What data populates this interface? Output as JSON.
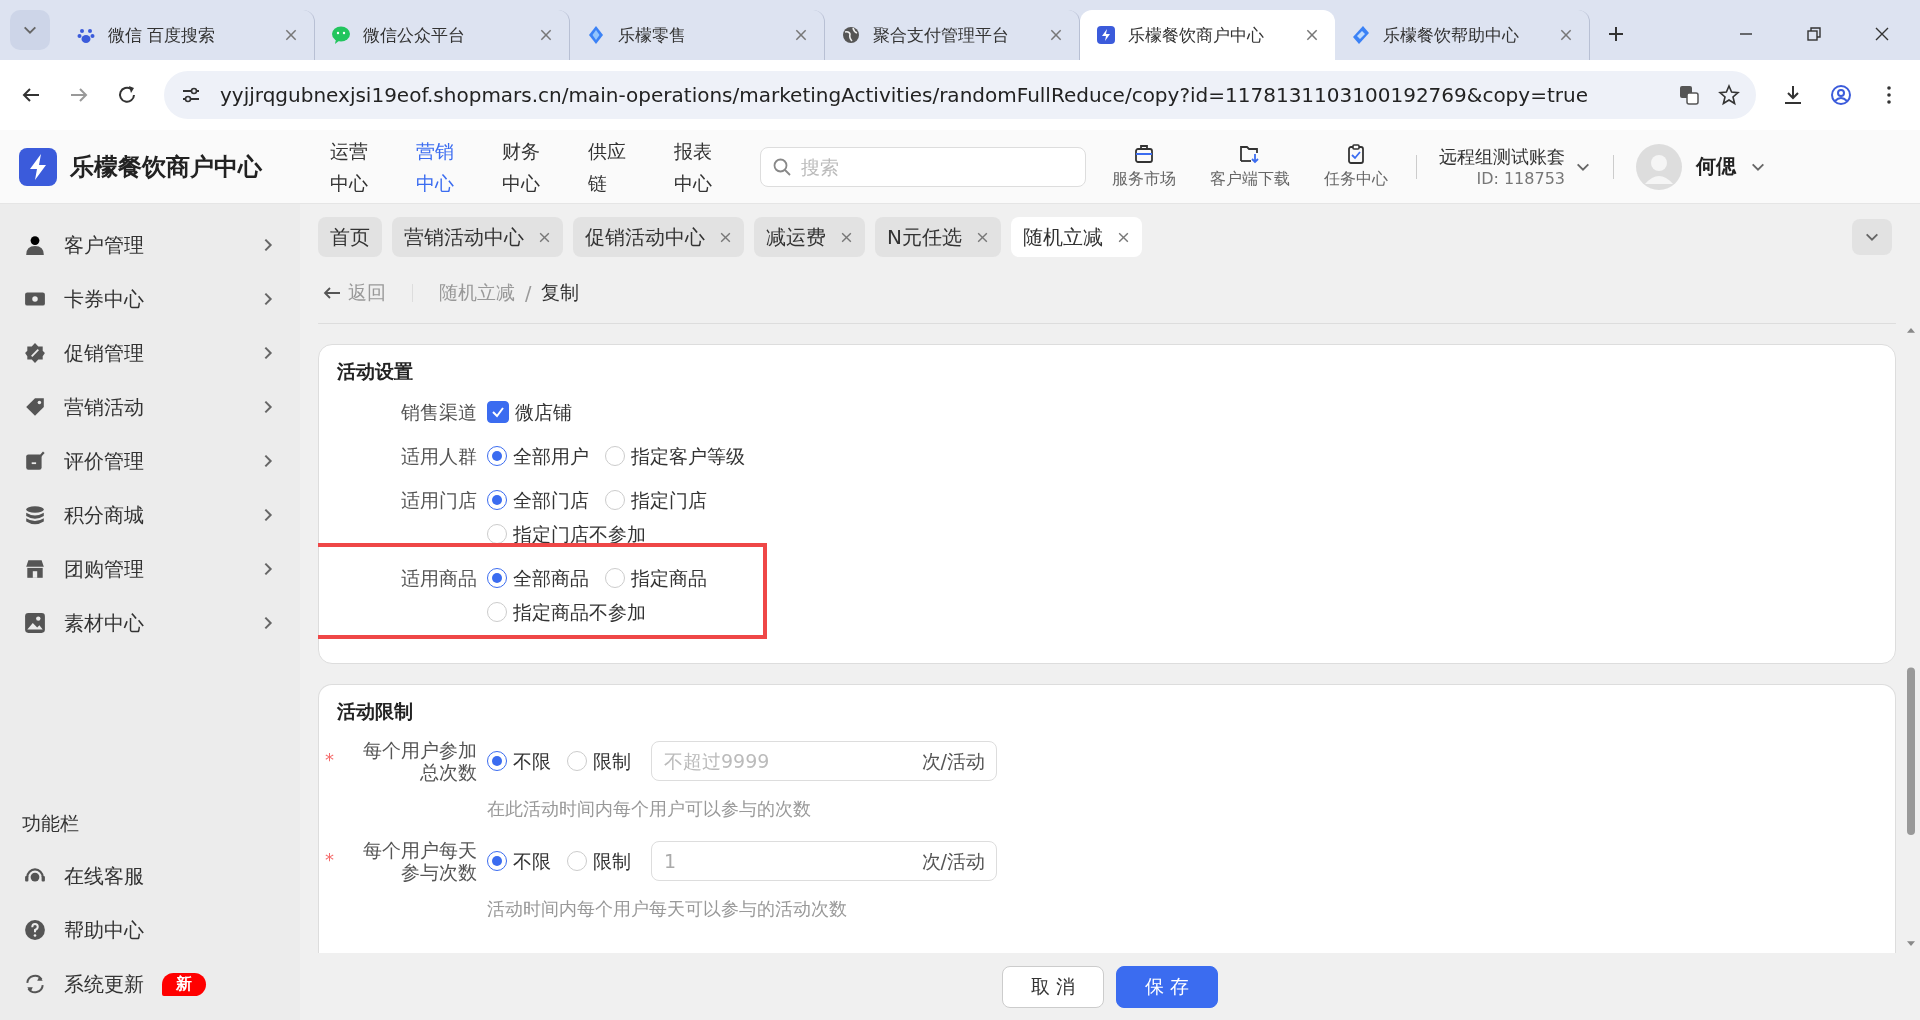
{
  "browser": {
    "tabs": [
      {
        "title": "微信 百度搜索",
        "selected": false
      },
      {
        "title": "微信公众平台",
        "selected": false
      },
      {
        "title": "乐檬零售",
        "selected": false
      },
      {
        "title": "聚合支付管理平台",
        "selected": false
      },
      {
        "title": "乐檬餐饮商户中心",
        "selected": true
      },
      {
        "title": "乐檬餐饮帮助中心",
        "selected": false
      }
    ],
    "url": "yyjjrqgubnexjsi19eof.shopmars.cn/main-operations/marketingActivities/randomFullReduce/copy?id=1178131103100192769&copy=true"
  },
  "header": {
    "logo": "乐檬餐饮商户中心",
    "nav": [
      {
        "label": "运营中心",
        "selected": false
      },
      {
        "label": "营销中心",
        "selected": true
      },
      {
        "label": "财务中心",
        "selected": false
      },
      {
        "label": "供应链",
        "selected": false
      },
      {
        "label": "报表中心",
        "selected": false
      }
    ],
    "search": {
      "placeholder": "搜索"
    },
    "tools": [
      {
        "label": "服务市场"
      },
      {
        "label": "客户端下载"
      },
      {
        "label": "任务中心"
      }
    ],
    "account": {
      "name": "远程组测试账套",
      "id": "ID: 118753"
    },
    "user": "何偲"
  },
  "sidebar": {
    "items": [
      {
        "label": "客户管理"
      },
      {
        "label": "卡券中心"
      },
      {
        "label": "促销管理"
      },
      {
        "label": "营销活动"
      },
      {
        "label": "评价管理"
      },
      {
        "label": "积分商城"
      },
      {
        "label": "团购管理"
      },
      {
        "label": "素材中心"
      }
    ],
    "section_title": "功能栏",
    "tools": [
      {
        "label": "在线客服"
      },
      {
        "label": "帮助中心"
      },
      {
        "label": "系统更新",
        "badge": "新"
      }
    ]
  },
  "page_tabs": [
    {
      "label": "首页",
      "closable": false,
      "selected": false
    },
    {
      "label": "营销活动中心",
      "closable": true,
      "selected": false
    },
    {
      "label": "促销活动中心",
      "closable": true,
      "selected": false
    },
    {
      "label": "减运费",
      "closable": true,
      "selected": false
    },
    {
      "label": "N元任选",
      "closable": true,
      "selected": false
    },
    {
      "label": "随机立减",
      "closable": true,
      "selected": true
    }
  ],
  "breadcrumb": {
    "back": "返回",
    "items": [
      "随机立减",
      "复制"
    ],
    "separator": "/"
  },
  "sections": [
    {
      "title": "活动设置",
      "rows": [
        {
          "kind": "checkbox",
          "label": "销售渠道",
          "options": [
            {
              "label": "微店铺",
              "checked": true
            }
          ]
        },
        {
          "kind": "radio",
          "label": "适用人群",
          "options": [
            {
              "label": "全部用户",
              "selected": true
            },
            {
              "label": "指定客户等级",
              "selected": false
            }
          ]
        },
        {
          "kind": "radio",
          "label": "适用门店",
          "options": [
            {
              "label": "全部门店",
              "selected": true
            },
            {
              "label": "指定门店",
              "selected": false
            },
            {
              "label": "指定门店不参加",
              "selected": false
            }
          ]
        },
        {
          "kind": "radio",
          "label": "适用商品",
          "highlighted": true,
          "options": [
            {
              "label": "全部商品",
              "selected": true
            },
            {
              "label": "指定商品",
              "selected": false
            },
            {
              "label": "指定商品不参加",
              "selected": false
            }
          ]
        }
      ]
    },
    {
      "title": "活动限制",
      "rows": [
        {
          "kind": "radio_input",
          "label": "每个用户参加总次数",
          "required_mark": "*",
          "options": [
            {
              "label": "不限",
              "selected": true
            },
            {
              "label": "限制",
              "selected": false
            }
          ],
          "input": {
            "placeholder": "不超过9999",
            "suffix": "次/活动"
          },
          "help": "在此活动时间内每个用户可以参与的次数"
        },
        {
          "kind": "radio_input",
          "label": "每个用户每天参与次数",
          "required_mark": "*",
          "options": [
            {
              "label": "不限",
              "selected": true
            },
            {
              "label": "限制",
              "selected": false
            }
          ],
          "input": {
            "value": "1",
            "suffix": "次/活动"
          },
          "help": "活动时间内每个用户每天可以参与的活动次数"
        }
      ]
    }
  ],
  "footer": [
    {
      "label": "取 消",
      "kind": "default"
    },
    {
      "label": "保 存",
      "kind": "primary"
    }
  ]
}
